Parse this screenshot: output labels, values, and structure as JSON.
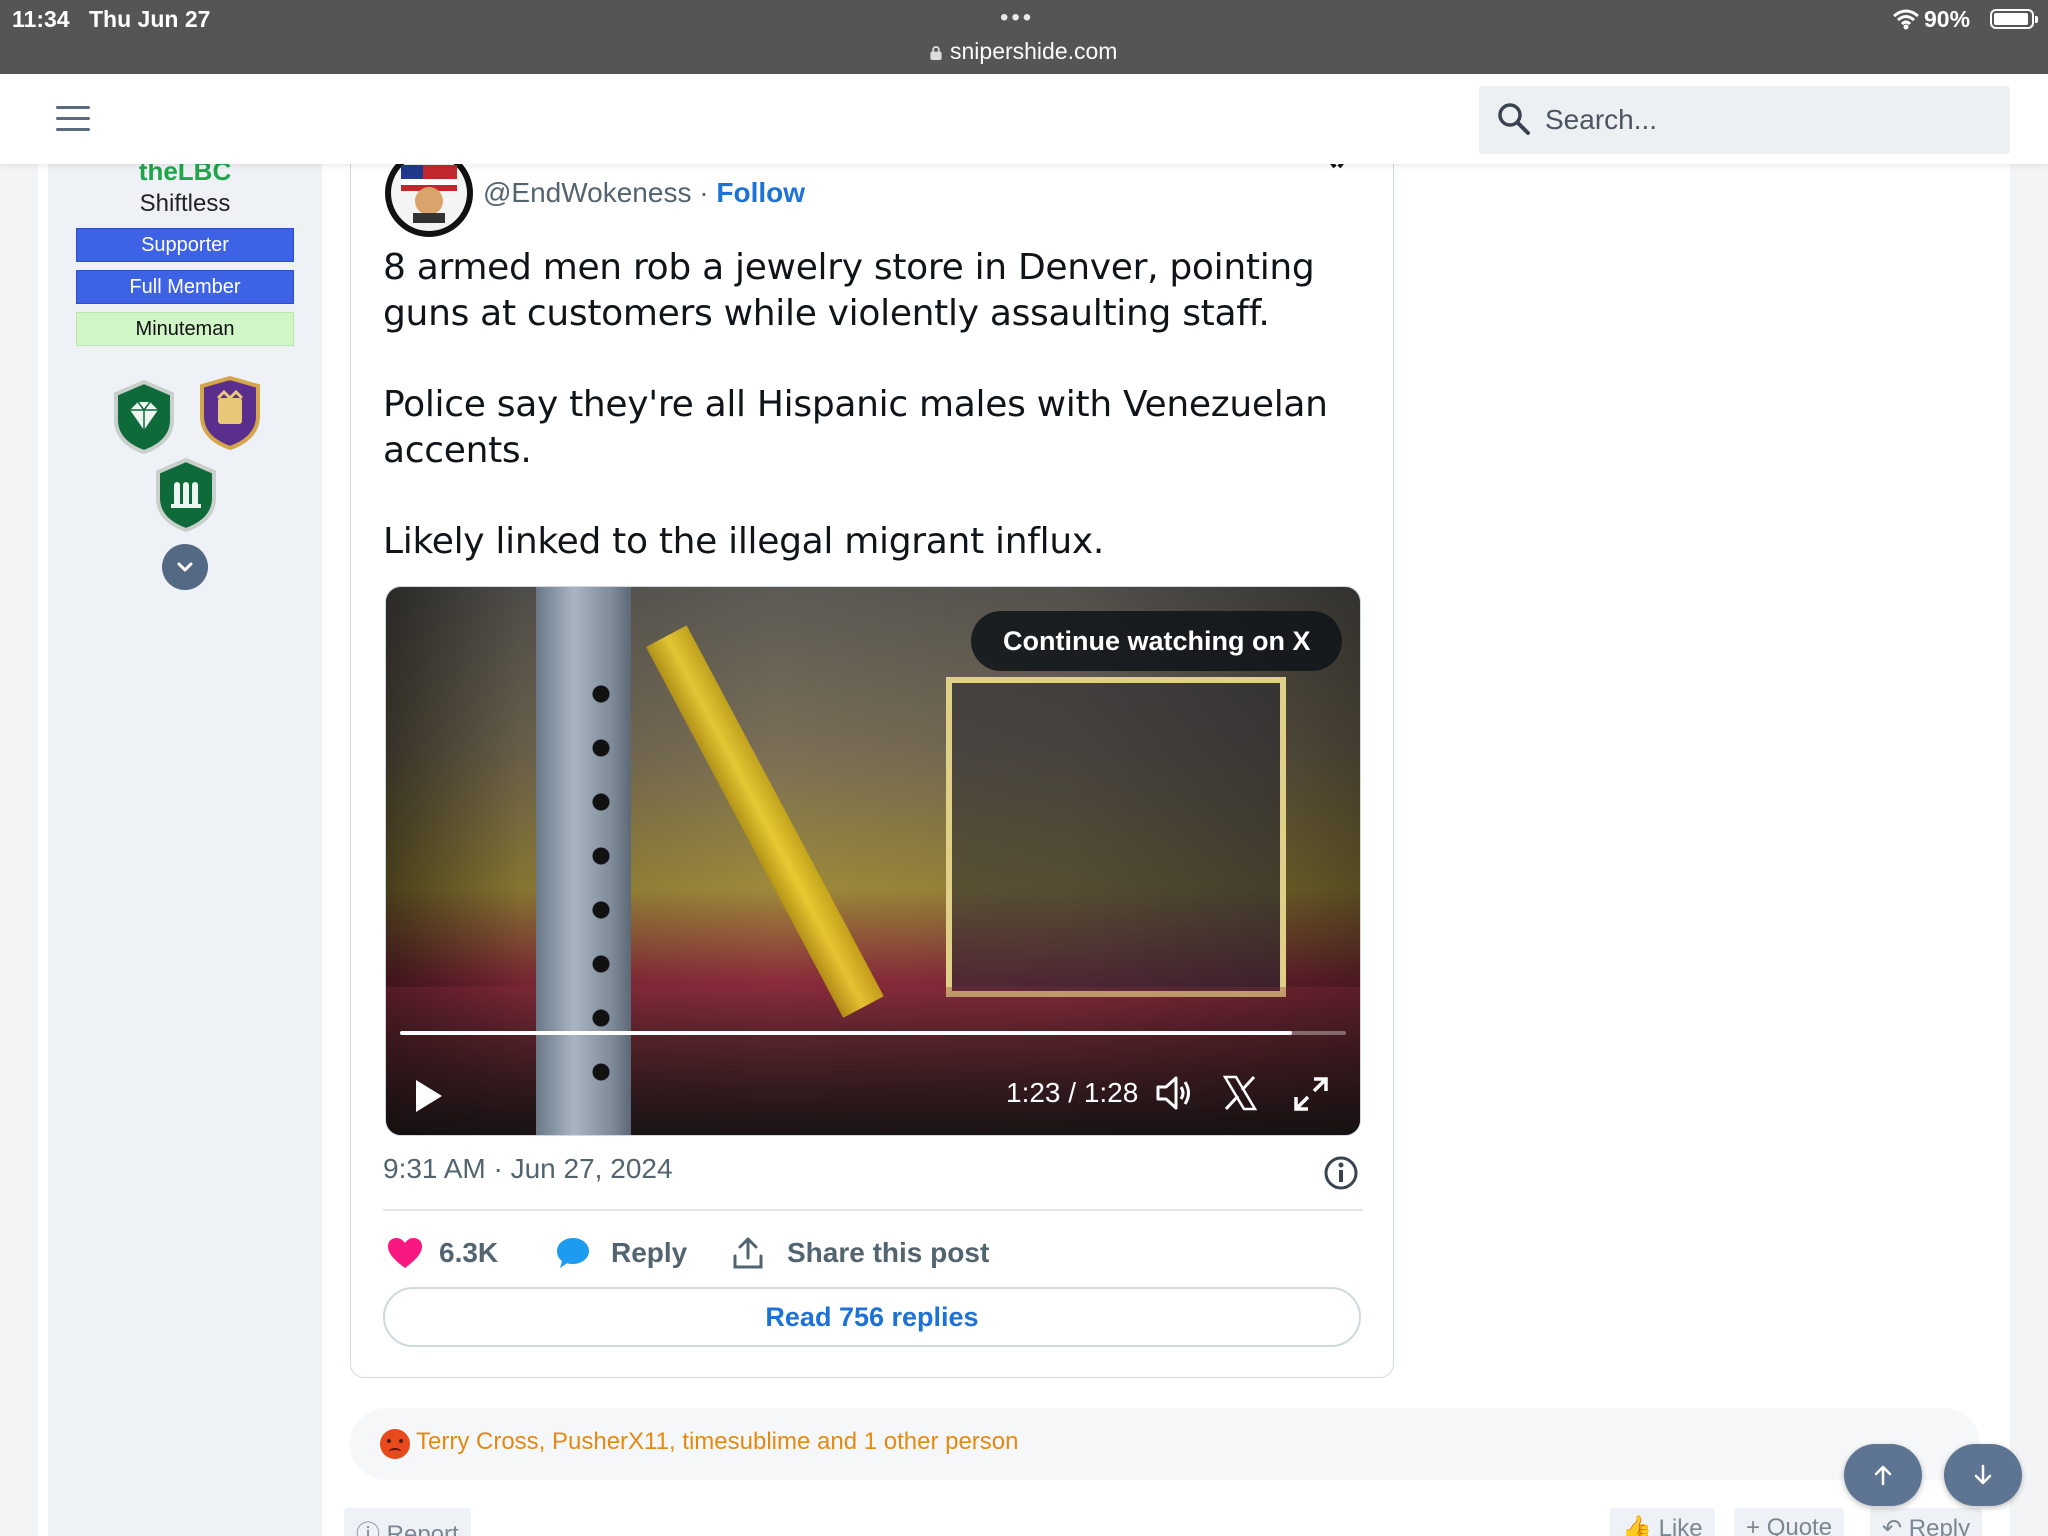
{
  "status_bar": {
    "time": "11:34",
    "date": "Thu Jun 27",
    "url": "snipershide.com",
    "battery": "90%"
  },
  "header": {
    "search_placeholder": "Search..."
  },
  "user_panel": {
    "username": "theLBC",
    "title": "Shiftless",
    "banners": [
      "Supporter",
      "Full Member",
      "Minuteman"
    ],
    "trophy_icons": [
      "diamond-trophy-icon",
      "crown-trophy-icon",
      "ammo-trophy-icon"
    ]
  },
  "tweet": {
    "handle": "@EndWokeness",
    "separator": "·",
    "follow": "Follow",
    "paragraphs": [
      "8 armed men rob a jewelry store in Denver, pointing guns at customers while violently assaulting staff.",
      "Police say they're all Hispanic males with Venezuelan accents.",
      "Likely linked to the illegal migrant influx."
    ],
    "video": {
      "continue_label": "Continue watching on X",
      "time": "1:23 / 1:28",
      "progress": 0.943
    },
    "timestamp": "9:31 AM · Jun 27, 2024",
    "likes": "6.3K",
    "reply": "Reply",
    "share": "Share this post",
    "read_replies": "Read 756 replies"
  },
  "reactions": {
    "names": "Terry Cross, PusherX11, timesublime and 1 other person"
  },
  "footer_actions": {
    "report": "Report",
    "like": "Like",
    "quote": "Quote",
    "reply": "Reply"
  },
  "colors": {
    "accent_green": "#22b14c",
    "banner_blue": "#3e62e6",
    "banner_green": "#d0f5c6",
    "link_blue": "#1d72d8",
    "heart_pink": "#f91880",
    "reaction_orange": "#e48a12"
  }
}
